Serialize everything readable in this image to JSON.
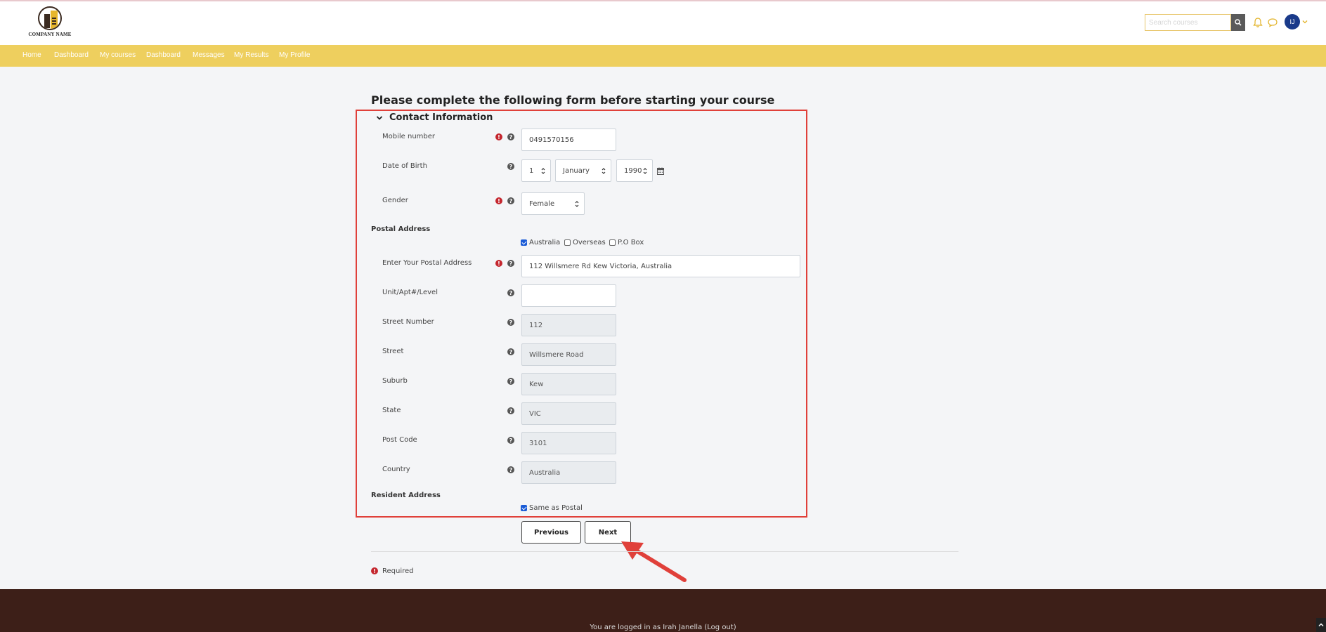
{
  "header": {
    "logo_text": "COMPANY NAME",
    "search_placeholder": "Search courses",
    "avatar_initials": "IJ"
  },
  "nav": {
    "items": [
      "Home",
      "Dashboard",
      "My courses",
      "Dashboard",
      "Messages",
      "My Results",
      "My Profile"
    ]
  },
  "page": {
    "heading": "Please complete the following form before starting your course",
    "section_title": "Contact Information"
  },
  "form": {
    "mobile_label": "Mobile number",
    "mobile_value": "0491570156",
    "dob_label": "Date of Birth",
    "dob_day": "1",
    "dob_month": "January",
    "dob_year": "1990",
    "gender_label": "Gender",
    "gender_value": "Female",
    "postal_group": "Postal Address",
    "postal_options": [
      {
        "label": "Australia",
        "checked": true
      },
      {
        "label": "Overseas",
        "checked": false
      },
      {
        "label": "P.O Box",
        "checked": false
      }
    ],
    "postal_address_label": "Enter Your Postal Address",
    "postal_address_value": "112 Willsmere Rd Kew Victoria, Australia",
    "unit_label": "Unit/Apt#/Level",
    "unit_value": "",
    "street_number_label": "Street Number",
    "street_number_value": "112",
    "street_label": "Street",
    "street_value": "Willsmere Road",
    "suburb_label": "Suburb",
    "suburb_value": "Kew",
    "state_label": "State",
    "state_value": "VIC",
    "postcode_label": "Post Code",
    "postcode_value": "3101",
    "country_label": "Country",
    "country_value": "Australia",
    "resident_group": "Resident Address",
    "same_as_postal_label": "Same as Postal",
    "same_as_postal_checked": true
  },
  "buttons": {
    "previous": "Previous",
    "next": "Next"
  },
  "required_note": "Required",
  "footer": {
    "logged_in_text": "You are logged in as Irah Janella (Log out)"
  },
  "colors": {
    "nav_bg": "#eecf5e",
    "footer_bg": "#3d1f18",
    "highlight_border": "#e0403a",
    "required_red": "#c4262e",
    "avatar_blue": "#1a3a8a"
  }
}
